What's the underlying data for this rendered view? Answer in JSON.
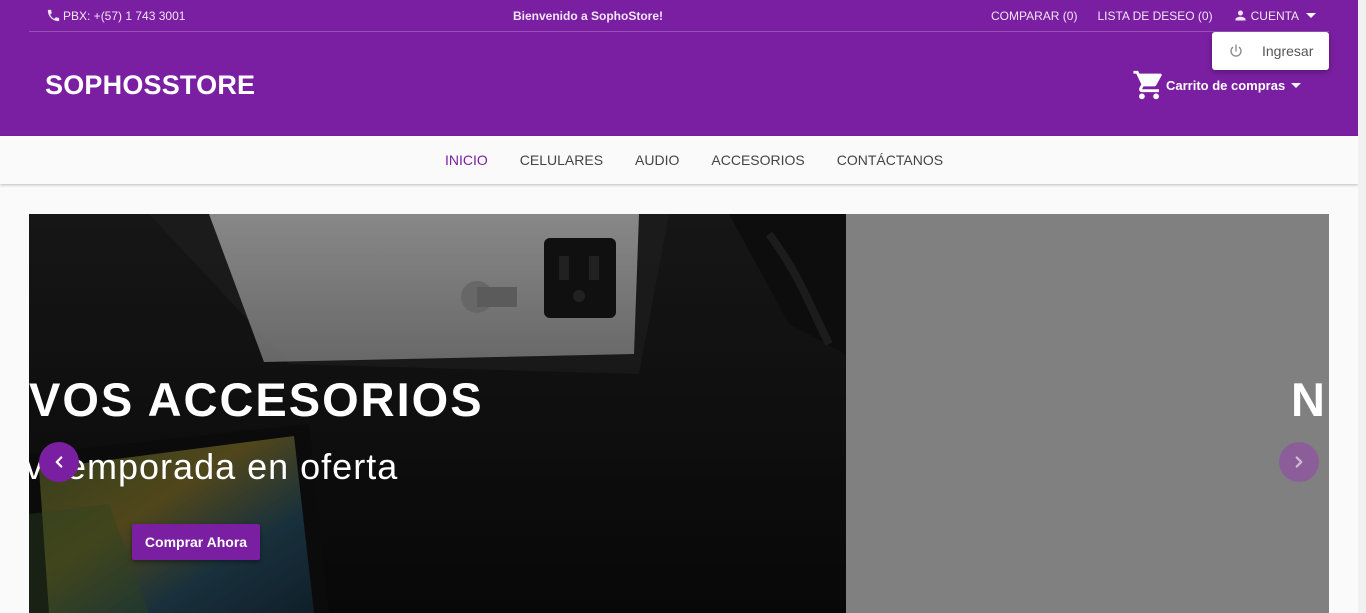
{
  "topbar": {
    "phone": "PBX: +(57) 1 743 3001",
    "welcome": "Bienvenido a SophoStore!",
    "compare": "COMPARAR (0)",
    "wishlist": "LISTA DE DESEO (0)",
    "account": "CUENTA"
  },
  "account_dropdown": {
    "items": [
      {
        "label": "Ingresar",
        "icon": "power-icon"
      }
    ]
  },
  "header": {
    "brand": "SOPHOSSTORE",
    "cart_label": "Carrito de compras"
  },
  "nav": {
    "items": [
      {
        "label": "INICIO",
        "active": true
      },
      {
        "label": "CELULARES",
        "active": false
      },
      {
        "label": "AUDIO",
        "active": false
      },
      {
        "label": "ACCESORIOS",
        "active": false
      },
      {
        "label": "CONTÁCTANOS",
        "active": false
      }
    ]
  },
  "carousel": {
    "headline": "VOS ACCESORIOS",
    "subline": "v temporada en oferta",
    "cta": "Comprar Ahora",
    "next_slide_letter": "N"
  },
  "colors": {
    "brand": "#7b1fa2",
    "nav_bg": "#fafafa",
    "next_slide_bg": "#808080"
  }
}
